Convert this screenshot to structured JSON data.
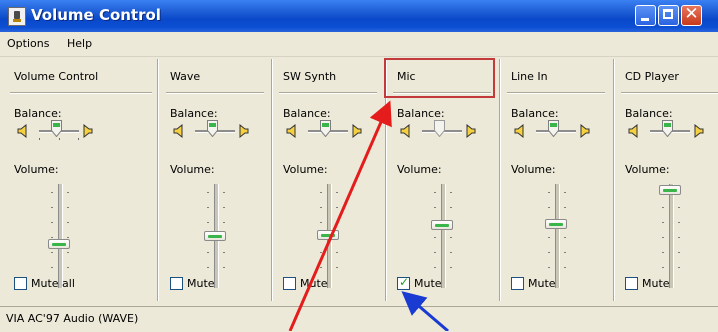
{
  "window": {
    "title": "Volume Control"
  },
  "menu": [
    "Options",
    "Help"
  ],
  "columns": [
    {
      "name": "Volume Control",
      "balance_label": "Balance:",
      "volume_label": "Volume:",
      "mute_label": "Mute all",
      "muted": false
    },
    {
      "name": "Wave",
      "balance_label": "Balance:",
      "volume_label": "Volume:",
      "mute_label": "Mute",
      "muted": false
    },
    {
      "name": "SW Synth",
      "balance_label": "Balance:",
      "volume_label": "Volume:",
      "mute_label": "Mute",
      "muted": false
    },
    {
      "name": "Mic",
      "balance_label": "Balance:",
      "volume_label": "Volume:",
      "mute_label": "Mute",
      "muted": true
    },
    {
      "name": "Line In",
      "balance_label": "Balance:",
      "volume_label": "Volume:",
      "mute_label": "Mute",
      "muted": false
    },
    {
      "name": "CD Player",
      "balance_label": "Balance:",
      "volume_label": "Volume:",
      "mute_label": "Mute",
      "muted": false
    }
  ],
  "status": {
    "text": "VIA AC'97 Audio (WAVE)"
  },
  "annotation_colors": {
    "highlight_box": "#c33a3a",
    "red_arrow": "#e51c1c",
    "blue_arrow": "#1a3bd1"
  }
}
